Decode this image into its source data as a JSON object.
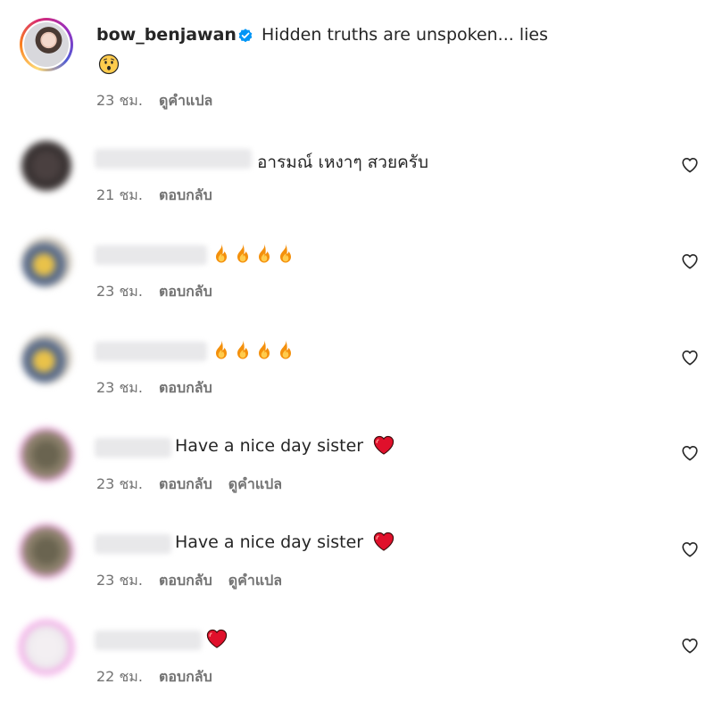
{
  "caption": {
    "username": "bow_benjawan",
    "text": "Hidden truths are unspoken... lies",
    "emoji_icon": "hushed-face-icon",
    "time": "23 ชม.",
    "translate_label": "ดูคำแปล"
  },
  "comments": [
    {
      "text": "อารมณ์ เหงาๆ สวยครับ",
      "time": "21 ชม.",
      "reply_label": "ตอบกลับ"
    },
    {
      "text": "",
      "emoji": [
        "fire-icon",
        "fire-icon",
        "fire-icon",
        "fire-icon"
      ],
      "time": "23 ชม.",
      "reply_label": "ตอบกลับ"
    },
    {
      "text": "",
      "emoji": [
        "fire-icon",
        "fire-icon",
        "fire-icon",
        "fire-icon"
      ],
      "time": "23 ชม.",
      "reply_label": "ตอบกลับ"
    },
    {
      "text": "Have a nice day sister",
      "emoji": [
        "red-heart-icon"
      ],
      "time": "23 ชม.",
      "reply_label": "ตอบกลับ",
      "translate_label": "ดูคำแปล"
    },
    {
      "text": "Have a nice day sister",
      "emoji": [
        "red-heart-icon"
      ],
      "time": "23 ชม.",
      "reply_label": "ตอบกลับ",
      "translate_label": "ดูคำแปล"
    },
    {
      "text": "",
      "emoji": [
        "red-heart-icon"
      ],
      "time": "22 ชม.",
      "reply_label": "ตอบกลับ"
    }
  ],
  "colors": {
    "text": "#262626",
    "meta": "#737373",
    "verified": "#0095f6",
    "heart_emoji": "#e0102b",
    "fire_outer": "#f4900c",
    "fire_inner": "#ffcc4d"
  }
}
